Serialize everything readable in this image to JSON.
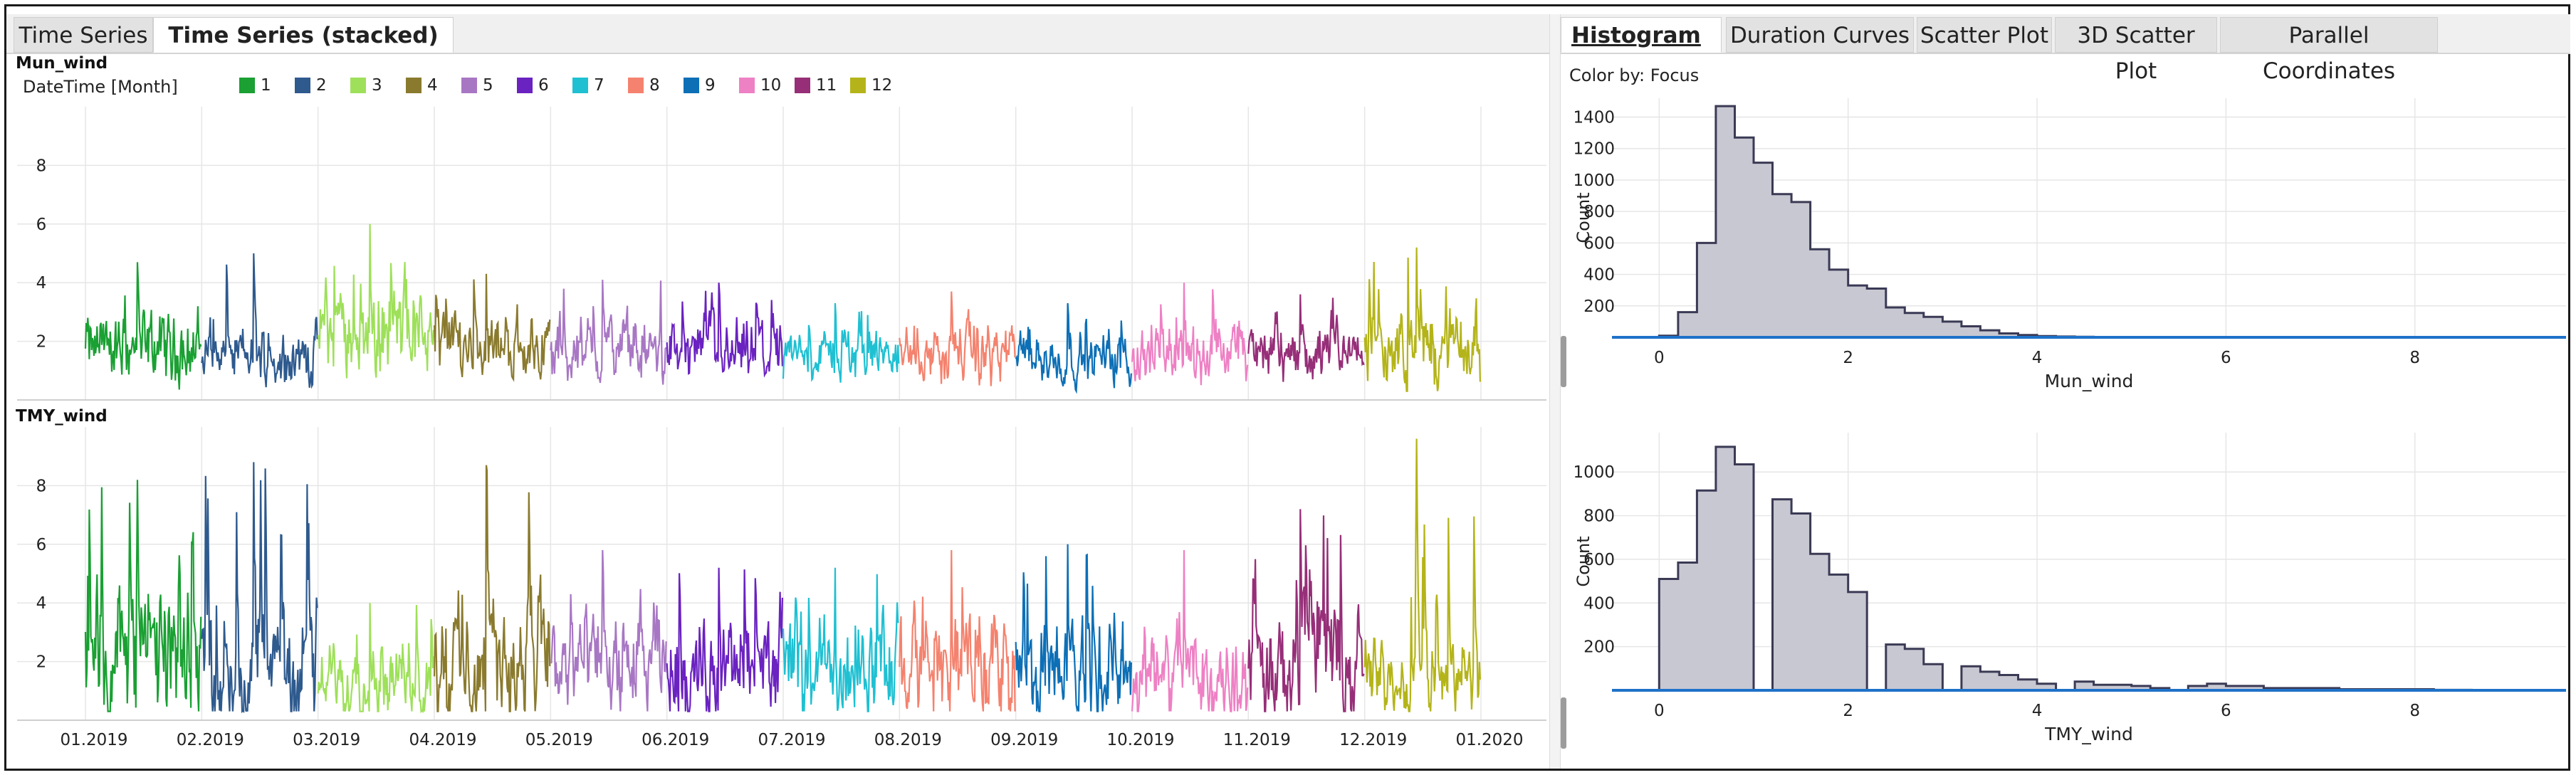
{
  "left_tabs": [
    "Time Series",
    "Time Series (stacked)"
  ],
  "left_active_tab": 1,
  "right_tabs": [
    "Histogram",
    "Duration Curves",
    "Scatter Plot",
    "3D Scatter Plot",
    "Parallel Coordinates"
  ],
  "right_active_tab": 0,
  "color_by_label": "Color by: Focus",
  "legend": {
    "title": "DateTime [Month]",
    "items": [
      {
        "label": "1",
        "color": "#1aa033"
      },
      {
        "label": "2",
        "color": "#2e5a8e"
      },
      {
        "label": "3",
        "color": "#9ee05a"
      },
      {
        "label": "4",
        "color": "#8a7a2e"
      },
      {
        "label": "5",
        "color": "#a877c4"
      },
      {
        "label": "6",
        "color": "#6a22c0"
      },
      {
        "label": "7",
        "color": "#1fc0d2"
      },
      {
        "label": "8",
        "color": "#f4826e"
      },
      {
        "label": "9",
        "color": "#0d6fb6"
      },
      {
        "label": "10",
        "color": "#ee80c4"
      },
      {
        "label": "11",
        "color": "#962e78"
      },
      {
        "label": "12",
        "color": "#b4b41a"
      }
    ]
  },
  "chart_data": [
    {
      "type": "line",
      "title": "Mun_wind",
      "x_tick_labels": [
        "01.2019",
        "02.2019",
        "03.2019",
        "04.2019",
        "05.2019",
        "06.2019",
        "07.2019",
        "08.2019",
        "09.2019",
        "10.2019",
        "11.2019",
        "12.2019",
        "01.2020"
      ],
      "ylim": [
        0,
        10
      ],
      "y_ticks": [
        2,
        4,
        6,
        8
      ],
      "series_by_month": [
        {
          "month": "1",
          "base": 1.8,
          "amp": 1.4,
          "peak": 4.7
        },
        {
          "month": "2",
          "base": 1.5,
          "amp": 1.1,
          "peak": 5.0
        },
        {
          "month": "3",
          "base": 2.4,
          "amp": 1.8,
          "peak": 6.0
        },
        {
          "month": "4",
          "base": 1.9,
          "amp": 1.3,
          "peak": 4.3
        },
        {
          "month": "5",
          "base": 1.7,
          "amp": 1.3,
          "peak": 4.1
        },
        {
          "month": "6",
          "base": 1.6,
          "amp": 1.3,
          "peak": 4.0
        },
        {
          "month": "7",
          "base": 1.5,
          "amp": 1.0,
          "peak": 3.3
        },
        {
          "month": "8",
          "base": 1.6,
          "amp": 1.2,
          "peak": 3.7
        },
        {
          "month": "9",
          "base": 1.4,
          "amp": 1.0,
          "peak": 3.3
        },
        {
          "month": "10",
          "base": 1.6,
          "amp": 1.2,
          "peak": 4.0
        },
        {
          "month": "11",
          "base": 1.6,
          "amp": 1.2,
          "peak": 3.6
        },
        {
          "month": "12",
          "base": 1.7,
          "amp": 1.5,
          "peak": 5.2
        }
      ]
    },
    {
      "type": "line",
      "title": "TMY_wind",
      "x_tick_labels": [
        "01.2019",
        "02.2019",
        "03.2019",
        "04.2019",
        "05.2019",
        "06.2019",
        "07.2019",
        "08.2019",
        "09.2019",
        "10.2019",
        "11.2019",
        "12.2019",
        "01.2020"
      ],
      "ylim": [
        0,
        10
      ],
      "y_ticks": [
        2,
        4,
        6,
        8
      ],
      "series_by_month": [
        {
          "month": "1",
          "base": 2.2,
          "amp": 3.0,
          "peak": 8.2
        },
        {
          "month": "2",
          "base": 1.8,
          "amp": 2.4,
          "peak": 8.8
        },
        {
          "month": "3",
          "base": 1.3,
          "amp": 1.4,
          "peak": 4.0
        },
        {
          "month": "4",
          "base": 2.0,
          "amp": 2.6,
          "peak": 8.7
        },
        {
          "month": "5",
          "base": 1.8,
          "amp": 2.2,
          "peak": 5.8
        },
        {
          "month": "6",
          "base": 1.7,
          "amp": 2.0,
          "peak": 5.2
        },
        {
          "month": "7",
          "base": 1.7,
          "amp": 2.0,
          "peak": 5.2
        },
        {
          "month": "8",
          "base": 1.8,
          "amp": 2.2,
          "peak": 5.8
        },
        {
          "month": "9",
          "base": 1.6,
          "amp": 2.0,
          "peak": 6.0
        },
        {
          "month": "10",
          "base": 1.6,
          "amp": 2.0,
          "peak": 5.8
        },
        {
          "month": "11",
          "base": 1.9,
          "amp": 2.4,
          "peak": 7.2
        },
        {
          "month": "12",
          "base": 1.4,
          "amp": 1.6,
          "peak": 9.6
        }
      ]
    },
    {
      "type": "bar",
      "subtype": "histogram",
      "xlabel": "Mun_wind",
      "ylabel": "Count",
      "xlim": [
        -0.5,
        9.6
      ],
      "ylim": [
        0,
        1520
      ],
      "x_ticks": [
        0,
        2,
        4,
        6,
        8
      ],
      "y_ticks": [
        200,
        400,
        600,
        800,
        1000,
        1200,
        1400
      ],
      "bin_width": 0.2,
      "x_start": 0.0,
      "counts": [
        10,
        160,
        600,
        1470,
        1270,
        1110,
        910,
        860,
        560,
        430,
        330,
        310,
        190,
        155,
        130,
        100,
        70,
        45,
        25,
        15,
        8,
        5,
        3,
        2,
        1,
        1,
        1,
        1,
        0,
        0,
        0,
        0,
        0,
        0,
        0,
        0,
        0,
        0,
        0,
        0,
        0,
        0,
        0,
        0,
        0,
        0,
        0,
        0
      ]
    },
    {
      "type": "bar",
      "subtype": "histogram",
      "xlabel": "TMY_wind",
      "ylabel": "Count",
      "xlim": [
        -0.5,
        9.6
      ],
      "ylim": [
        0,
        1180
      ],
      "x_ticks": [
        0,
        2,
        4,
        6,
        8
      ],
      "y_ticks": [
        200,
        400,
        600,
        800,
        1000
      ],
      "bin_width": 0.2,
      "x_start": 0.0,
      "counts": [
        510,
        585,
        915,
        1115,
        1035,
        0,
        875,
        810,
        625,
        530,
        450,
        0,
        210,
        190,
        120,
        0,
        110,
        85,
        70,
        50,
        30,
        0,
        40,
        25,
        25,
        20,
        10,
        0,
        20,
        30,
        20,
        20,
        10,
        10,
        10,
        10,
        5,
        5,
        5,
        5,
        5,
        2,
        2,
        0,
        0,
        0,
        0,
        0
      ]
    }
  ]
}
